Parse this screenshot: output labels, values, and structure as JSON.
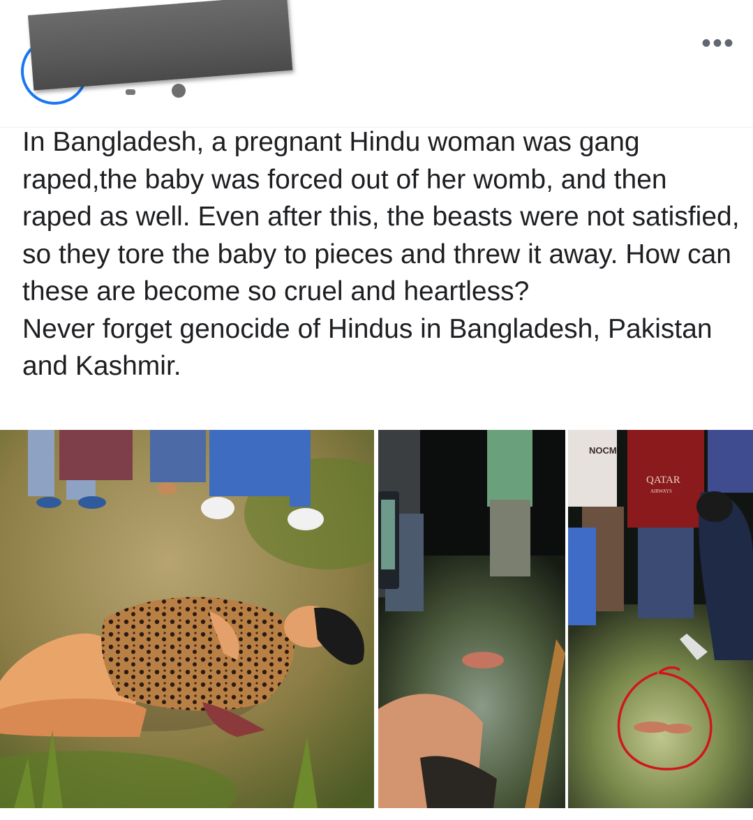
{
  "post": {
    "more_icon": "more-horizontal-icon",
    "privacy_icon": "globe-icon",
    "text_lines": [
      "In Bangladesh, a pregnant Hindu woman was gang raped,the baby was forced out of her womb, and then raped as well. Even after this, the beasts were not satisfied, so they tore the baby to pieces and threw it away. How can these are become so cruel and heartless?",
      "Never forget genocide of Hindus in Bangladesh, Pakistan and Kashmir."
    ],
    "more_glyph": "•••"
  },
  "photos": [
    {
      "kind": "illustration",
      "caption": ""
    },
    {
      "kind": "night-photo",
      "caption": ""
    },
    {
      "kind": "night-photo",
      "caption": "",
      "shirt_text": "NOCM",
      "shirt2_text": "QATAR",
      "shirt2_sub": "AIRWAYS"
    }
  ],
  "colors": {
    "avatar_ring": "#1877f2",
    "redaction": "#5e5e5e",
    "circle_mark": "#d0161c",
    "text": "#1c1e21"
  }
}
